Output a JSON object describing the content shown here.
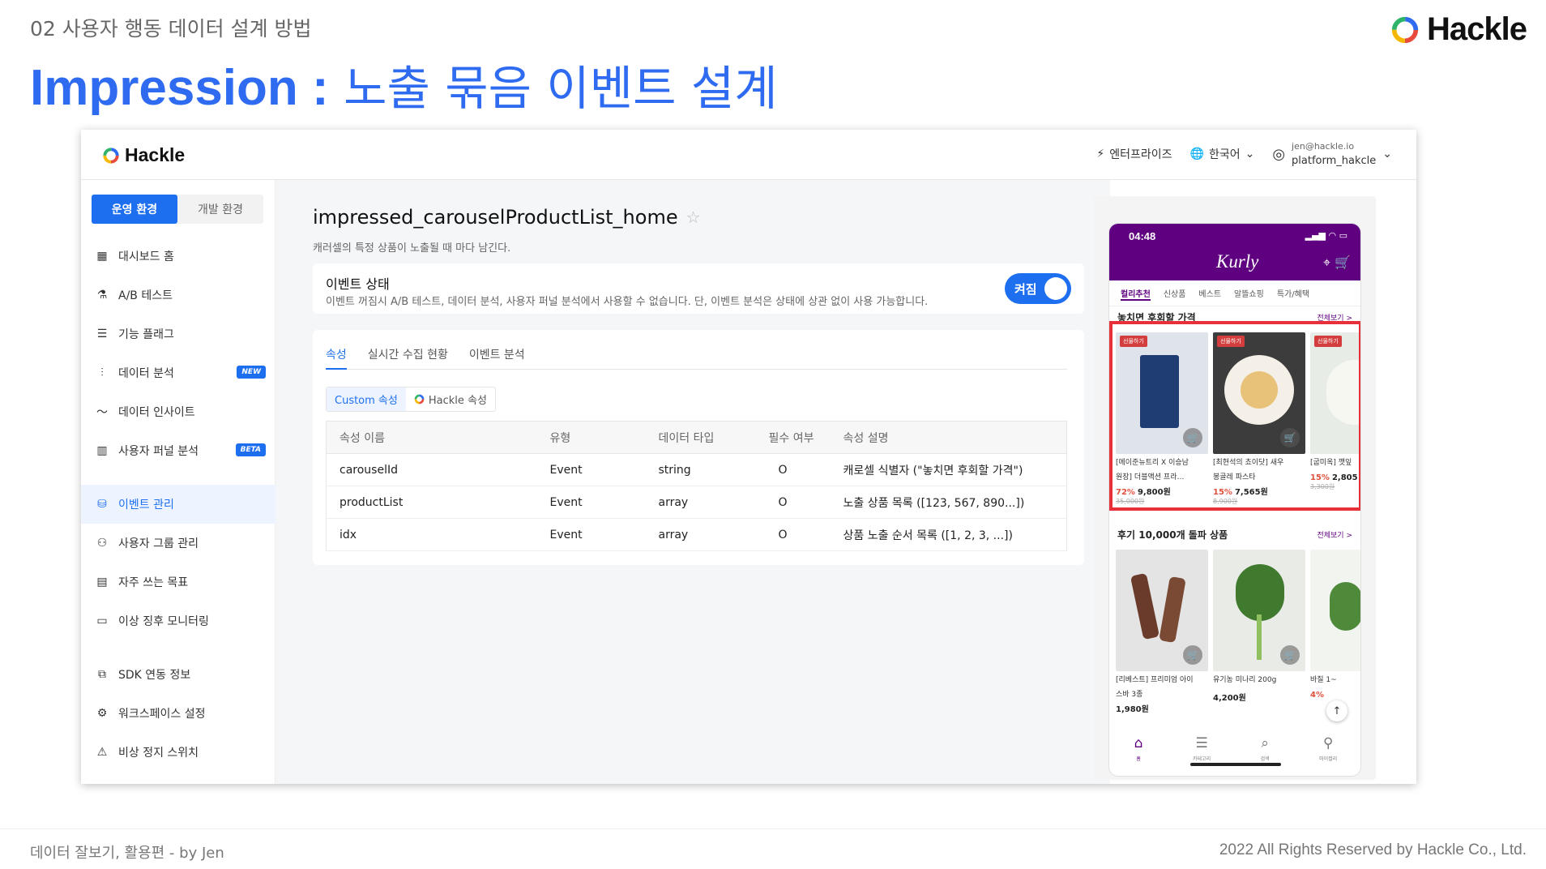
{
  "slide": {
    "section": "02 사용자 행동 데이터 설계 방법",
    "brand": "Hackle",
    "title_en": "Impression :",
    "title_ko": "노출 묶음 이벤트 설계",
    "footer_left": "데이터 잘보기, 활용편 - by Jen",
    "footer_right": "2022 All Rights Reserved by Hackle Co., Ltd."
  },
  "app": {
    "logo": "Hackle",
    "topbar": {
      "plan": "엔터프라이즈",
      "language": "한국어",
      "email": "jen@hackle.io",
      "workspace": "platform_hakcle"
    },
    "env_tabs": [
      "운영 환경",
      "개발 환경"
    ],
    "nav": [
      {
        "label": "대시보드 홈",
        "icon": "dashboard-icon"
      },
      {
        "label": "A/B 테스트",
        "icon": "flask-icon"
      },
      {
        "label": "기능 플래그",
        "icon": "toggle-icon"
      },
      {
        "label": "데이터 분석",
        "icon": "sliders-icon",
        "badge": "NEW"
      },
      {
        "label": "데이터 인사이트",
        "icon": "pulse-icon"
      },
      {
        "label": "사용자 퍼널 분석",
        "icon": "bar-chart-icon",
        "badge": "BETA"
      },
      {
        "label": "이벤트 관리",
        "icon": "database-icon"
      },
      {
        "label": "사용자 그룹 관리",
        "icon": "users-icon"
      },
      {
        "label": "자주 쓰는 목표",
        "icon": "target-chart-icon"
      },
      {
        "label": "이상 징후 모니터링",
        "icon": "monitor-icon"
      },
      {
        "label": "SDK 연동 정보",
        "icon": "code-icon"
      },
      {
        "label": "워크스페이스 설정",
        "icon": "gear-icon"
      },
      {
        "label": "비상 정지 스위치",
        "icon": "warning-icon"
      }
    ],
    "event": {
      "name": "impressed_carouselProductList_home",
      "description": "캐러셀의 특정 상품이 노출될 때 마다 남긴다.",
      "status_title": "이벤트 상태",
      "status_desc": "이벤트 꺼짐시 A/B 테스트, 데이터 분석, 사용자 퍼널 분석에서 사용할 수 없습니다. 단, 이벤트 분석은 상태에 상관 없이 사용 가능합니다.",
      "toggle_label": "켜짐"
    },
    "tabs": [
      "속성",
      "실시간 수집 현황",
      "이벤트 분석"
    ],
    "subtabs": [
      "Custom 속성",
      "Hackle 속성"
    ],
    "table": {
      "headers": [
        "속성 이름",
        "유형",
        "데이터 타입",
        "필수 여부",
        "속성 설명"
      ],
      "rows": [
        [
          "carouselId",
          "Event",
          "string",
          "O",
          "캐로셀 식별자 (\"놓치면 후회할 가격\")"
        ],
        [
          "productList",
          "Event",
          "array",
          "O",
          "노출 상품 목록 ([123, 567, 890...])"
        ],
        [
          "idx",
          "Event",
          "array",
          "O",
          "상품 노출 순서 목록 ([1, 2, 3, ...])"
        ]
      ]
    }
  },
  "phone": {
    "time": "04:48",
    "brand": "Kurly",
    "tabs": [
      "컬리추천",
      "신상품",
      "베스트",
      "알뜰쇼핑",
      "특가/혜택"
    ],
    "section1": {
      "title": "놓치면 후회할 가격",
      "more": "전체보기 >"
    },
    "section2": {
      "title": "후기 10,000개 돌파 상품",
      "more": "전체보기 >"
    },
    "row1": [
      {
        "tag": "선물하기",
        "name1": "[메이준뉴트리 X 이승남",
        "name2": "원장] 더블액션 프라…",
        "discount": "72%",
        "price": "9,800원",
        "orig": "35,000원",
        "color": "#dfe3ea"
      },
      {
        "tag": "선물하기",
        "name1": "[최현석의 쵸이닷] 새우",
        "name2": "봉골레 파스타",
        "discount": "15%",
        "price": "7,565원",
        "orig": "8,900원",
        "color": "#3c3c3c"
      },
      {
        "tag": "선물하기",
        "name1": "[굽미옥] 깻잎",
        "name2": "",
        "discount": "15%",
        "price": "2,805",
        "orig": "3,300원",
        "color": "#e8ece6"
      }
    ],
    "row2": [
      {
        "name1": "[리베스트] 프리미엄 아이",
        "name2": "스바 3종",
        "price": "1,980원",
        "color": "#e4e4e4"
      },
      {
        "name1": "유기농 미나리 200g",
        "name2": "",
        "price": "4,200원",
        "color": "#e9ebe6"
      },
      {
        "name1": "바질 1~",
        "name2": "",
        "price": "4%",
        "color": "#f2f4f0"
      }
    ],
    "bottom_nav": [
      "홈",
      "카테고리",
      "검색",
      "마이컬리"
    ]
  }
}
